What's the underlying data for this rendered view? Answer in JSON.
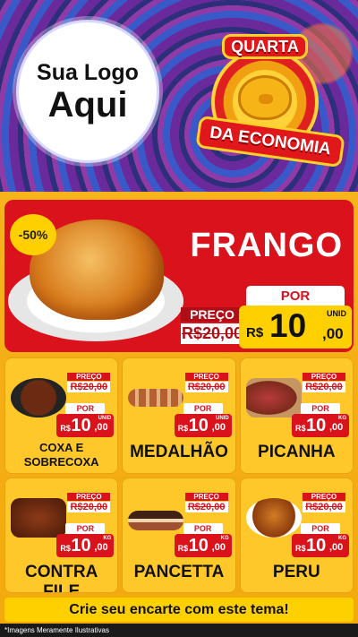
{
  "header": {
    "logo_line1": "Sua Logo",
    "logo_line2": "Aqui",
    "badge_top": "QUARTA",
    "badge_bottom": "DA ECONOMIA"
  },
  "hero": {
    "discount": "-50%",
    "title": "FRANGO",
    "preco_label": "PREÇO",
    "old_price": "R$20,00",
    "por_label": "POR",
    "price_currency": "R$",
    "price_int": "10",
    "price_dec": ",00",
    "unit": "UNID"
  },
  "products": [
    {
      "name": "COXA E SOBRECOXA",
      "preco_label": "PREÇO",
      "old_price": "R$20,00",
      "por_label": "POR",
      "currency": "R$",
      "int": "10",
      "dec": ",00",
      "unit": "UNID"
    },
    {
      "name": "MEDALHÃO",
      "preco_label": "PREÇO",
      "old_price": "R$20,00",
      "por_label": "POR",
      "currency": "R$",
      "int": "10",
      "dec": ",00",
      "unit": "UNID"
    },
    {
      "name": "PICANHA",
      "preco_label": "PREÇO",
      "old_price": "R$20,00",
      "por_label": "POR",
      "currency": "R$",
      "int": "10",
      "dec": ",00",
      "unit": "KG"
    },
    {
      "name": "CONTRA FILE",
      "preco_label": "PREÇO",
      "old_price": "R$20,00",
      "por_label": "POR",
      "currency": "R$",
      "int": "10",
      "dec": ",00",
      "unit": "KG"
    },
    {
      "name": "PANCETTA",
      "preco_label": "PREÇO",
      "old_price": "R$20,00",
      "por_label": "POR",
      "currency": "R$",
      "int": "10",
      "dec": ",00",
      "unit": "KG"
    },
    {
      "name": "PERU",
      "preco_label": "PREÇO",
      "old_price": "R$20,00",
      "por_label": "POR",
      "currency": "R$",
      "int": "10",
      "dec": ",00",
      "unit": "KG"
    }
  ],
  "cta": "Crie seu encarte com este tema!",
  "disclaimer": "*Imagens Meramente Ilustrativas",
  "colors": {
    "red": "#d9121c",
    "yellow": "#ffd000",
    "orange": "#f6b31c"
  }
}
